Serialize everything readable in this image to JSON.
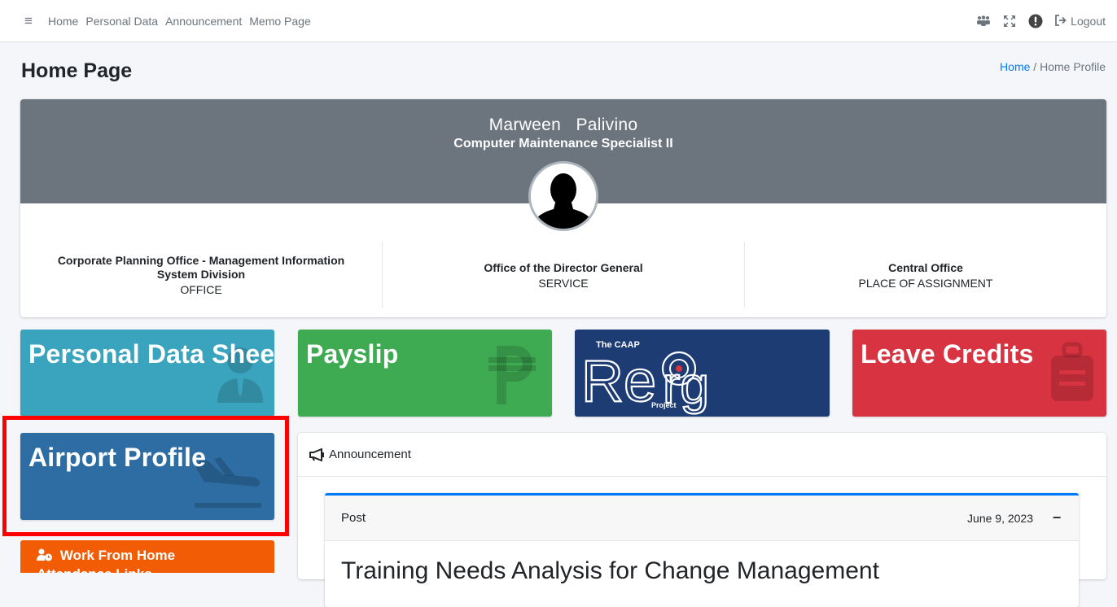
{
  "navbar": {
    "menu_icon": "hamburger-icon",
    "links": [
      "Home",
      "Personal Data",
      "Announcement",
      "Memo Page"
    ],
    "icons": [
      "users-icon",
      "expand-icon",
      "alert-icon"
    ],
    "logout_label": "Logout"
  },
  "page": {
    "title": "Home Page",
    "breadcrumb": {
      "home": "Home",
      "separator": "/",
      "current": "Home Profile"
    }
  },
  "profile": {
    "name": "Marween   Palivino",
    "position": "Computer Maintenance Specialist II",
    "stats": [
      {
        "value": "Corporate Planning Office - Management Information System Division",
        "label": "OFFICE"
      },
      {
        "value": "Office of the Director General",
        "label": "SERVICE"
      },
      {
        "value": "Central Office",
        "label": "PLACE OF ASSIGNMENT"
      }
    ]
  },
  "tiles": {
    "personal_data_sheet": "Personal Data Sheet",
    "payslip": "Payslip",
    "reorg": {
      "top": "The CAAP",
      "main": "Re-Org",
      "sub": "Project"
    },
    "leave_credits": "Leave Credits",
    "airport_profile": "Airport Profile"
  },
  "wfh": {
    "line1": "Work From Home",
    "line2": "Attendance Links"
  },
  "announcement": {
    "header": "Announcement",
    "post": {
      "label": "Post",
      "date": "June 9, 2023",
      "collapse": "−",
      "title": "Training Needs Analysis for Change Management"
    }
  },
  "colors": {
    "pds": "#3aa3bd",
    "payslip": "#3eab52",
    "reorg": "#1c3c73",
    "leave": "#d73341",
    "airport": "#2e6da4",
    "wfh": "#f25c05",
    "highlight": "#ff0000"
  }
}
